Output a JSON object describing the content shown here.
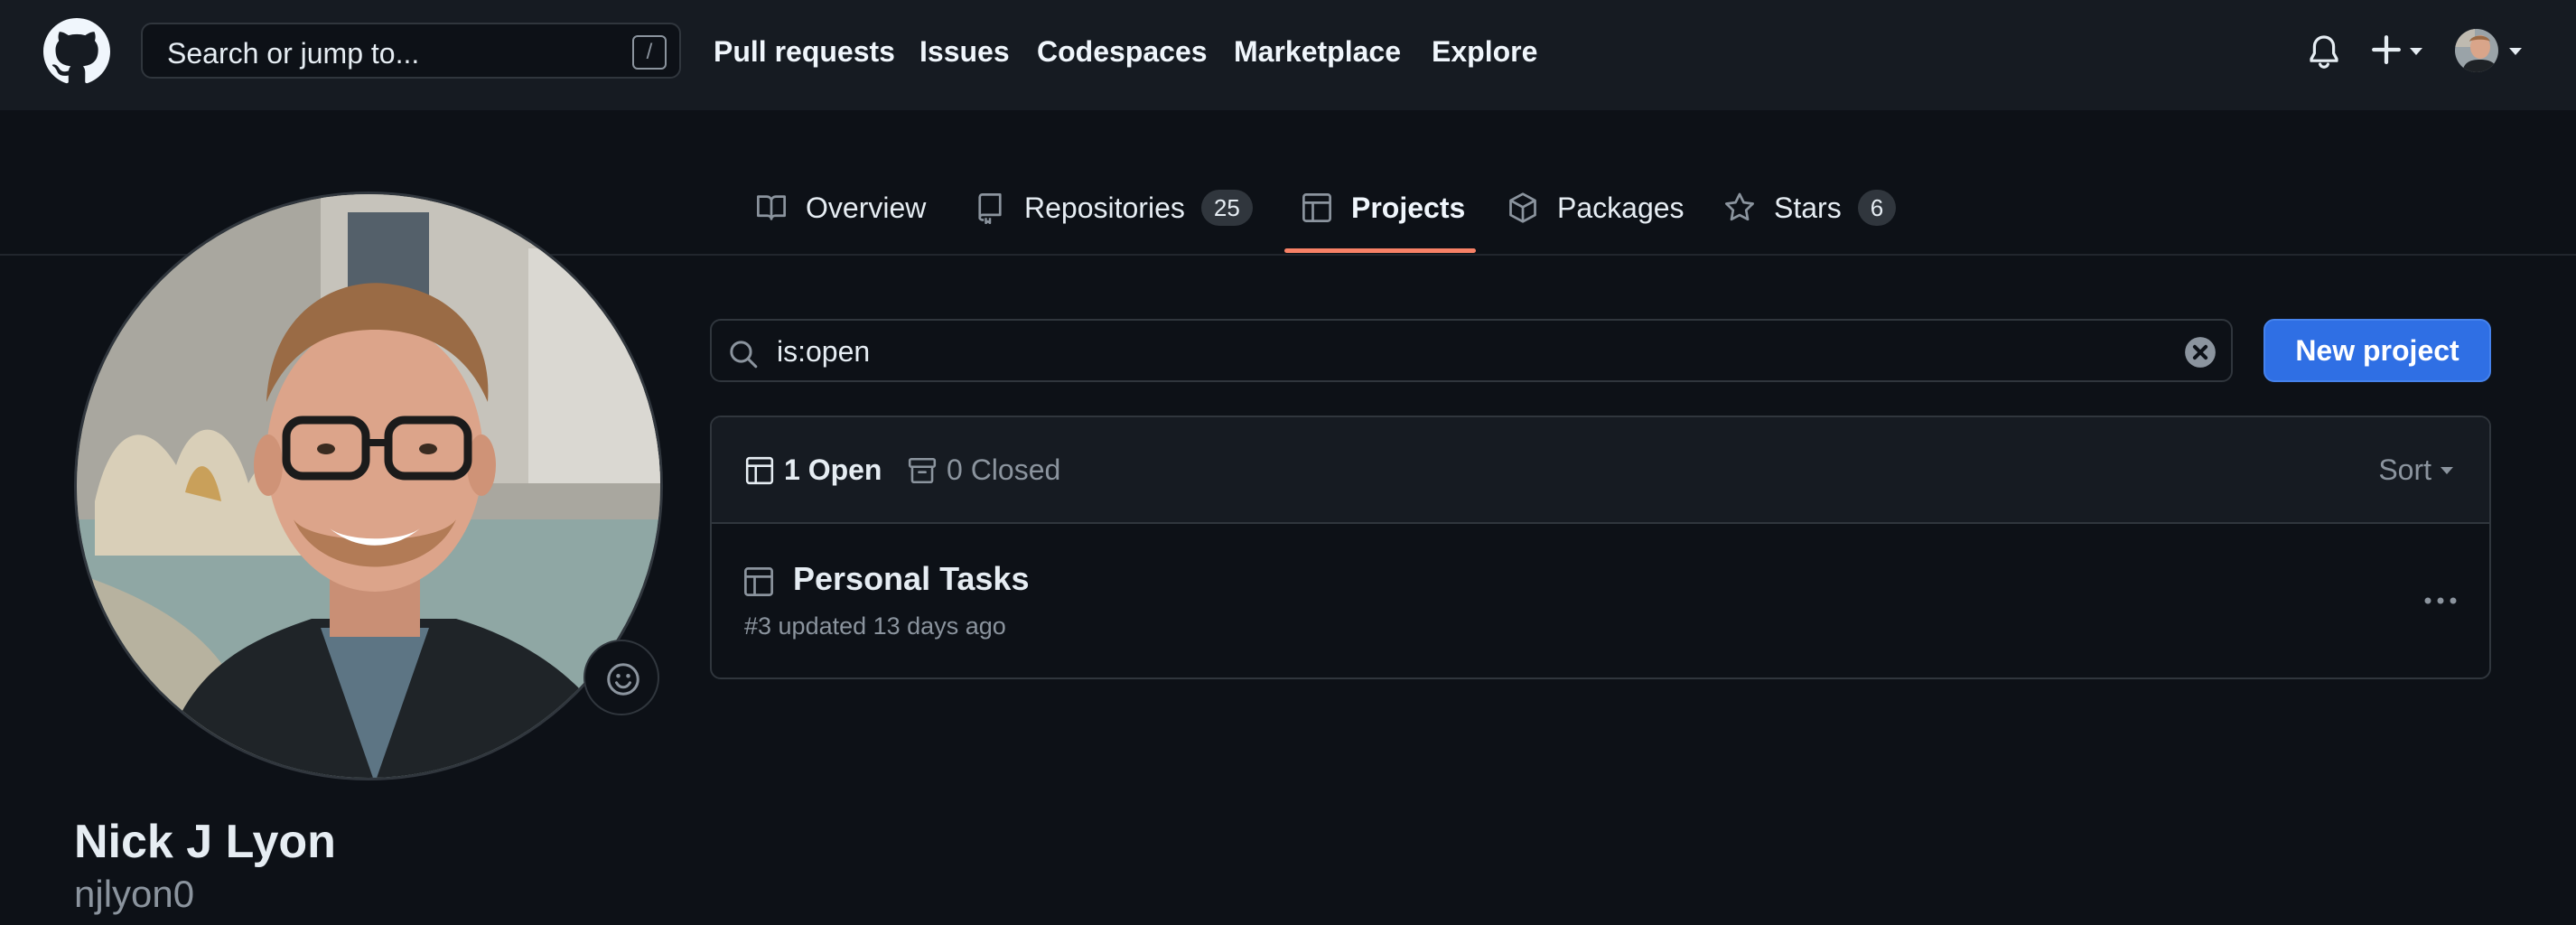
{
  "header": {
    "search_placeholder": "Search or jump to...",
    "search_shortcut": "/",
    "nav": [
      "Pull requests",
      "Issues",
      "Codespaces",
      "Marketplace",
      "Explore"
    ]
  },
  "tabs": [
    {
      "label": "Overview",
      "icon": "book-icon"
    },
    {
      "label": "Repositories",
      "icon": "repo-icon",
      "count": "25"
    },
    {
      "label": "Projects",
      "icon": "table-icon",
      "active": true
    },
    {
      "label": "Packages",
      "icon": "package-icon"
    },
    {
      "label": "Stars",
      "icon": "star-icon",
      "count": "6"
    }
  ],
  "profile": {
    "name": "Nick J Lyon",
    "login": "njlyon0"
  },
  "projects": {
    "filter_value": "is:open",
    "new_button": "New project",
    "open_label": "1 Open",
    "closed_label": "0 Closed",
    "sort_label": "Sort",
    "items": [
      {
        "title": "Personal Tasks",
        "meta": "#3 updated 13 days ago"
      }
    ]
  },
  "colors": {
    "background": "#0d1117",
    "header": "#161b22",
    "accent_underline": "#f78166",
    "primary_button": "#2f6fe4"
  }
}
